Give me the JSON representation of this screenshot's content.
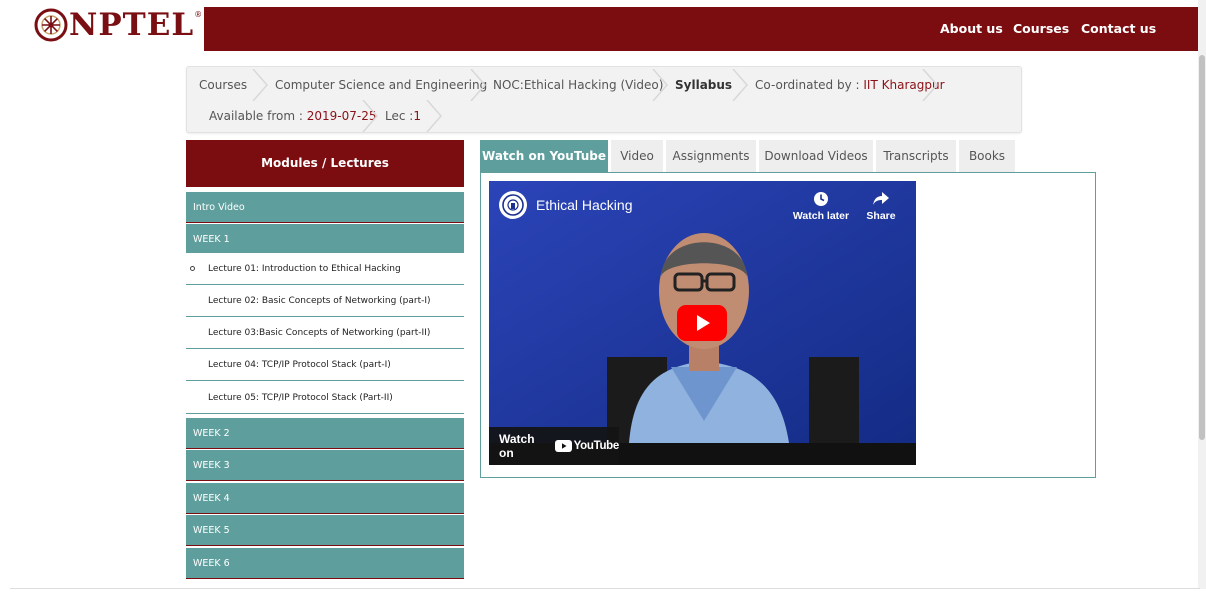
{
  "brand": {
    "logo_text": "NPTEL",
    "registered_mark": "®",
    "accent_color": "#7b0c10",
    "teal_color": "#5e9f9d"
  },
  "nav": {
    "about": "About us",
    "courses": "Courses",
    "contact": "Contact us"
  },
  "breadcrumb": {
    "courses": "Courses",
    "discipline": "Computer Science and Engineering",
    "course": "NOC:Ethical Hacking (Video)",
    "current": "Syllabus",
    "coordinated_label": "Co-ordinated by : ",
    "coordinated_value": "IIT Kharagpur",
    "available_label": "Available from : ",
    "available_value": "2019-07-25",
    "lec_label": "Lec :",
    "lec_value": "1"
  },
  "sidebar": {
    "heading": "Modules / Lectures",
    "intro": "Intro Video",
    "week1": "WEEK 1",
    "lectures": [
      "Lecture 01: Introduction to Ethical Hacking",
      "Lecture 02: Basic Concepts of Networking (part-I)",
      "Lecture 03:Basic Concepts of Networking (part-II)",
      "Lecture 04: TCP/IP Protocol Stack (part-I)",
      "Lecture 05: TCP/IP Protocol Stack (Part-II)"
    ],
    "weeks": [
      "WEEK 2",
      "WEEK 3",
      "WEEK 4",
      "WEEK 5",
      "WEEK 6"
    ]
  },
  "tabs": [
    "Watch on YouTube",
    "Video",
    "Assignments",
    "Download Videos",
    "Transcripts",
    "Books"
  ],
  "video": {
    "title": "Ethical Hacking",
    "watch_later": "Watch later",
    "share": "Share",
    "watch_on": "Watch on",
    "youtube": "YouTube",
    "icons": [
      "clock-icon",
      "share-arrow-icon",
      "play-icon",
      "youtube-logo-icon"
    ]
  }
}
